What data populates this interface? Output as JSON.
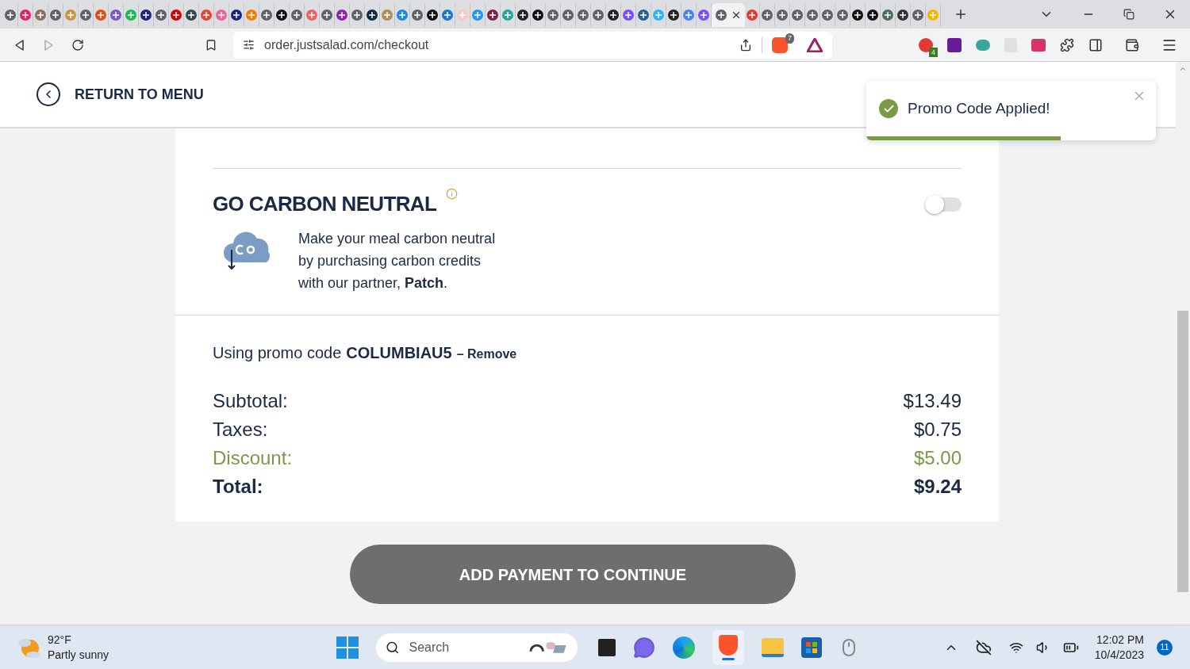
{
  "browser": {
    "tabs": [
      {
        "color": "#5f6368",
        "selected": false
      },
      {
        "color": "#e91e63",
        "selected": false
      },
      {
        "color": "#8d6e63",
        "selected": false
      },
      {
        "color": "#5f6368",
        "selected": false
      },
      {
        "color": "#c8963e",
        "selected": false
      },
      {
        "color": "#5f6368",
        "selected": false
      },
      {
        "color": "#e64a19",
        "selected": false
      },
      {
        "color": "#7e57c2",
        "selected": false
      },
      {
        "color": "#1db954",
        "selected": false
      },
      {
        "color": "#1a237e",
        "selected": false
      },
      {
        "color": "#5f6368",
        "selected": false
      },
      {
        "color": "#d50000",
        "selected": false
      },
      {
        "color": "#37474f",
        "selected": false
      },
      {
        "color": "#ea4335",
        "selected": false
      },
      {
        "color": "#f06292",
        "selected": false
      },
      {
        "color": "#1a237e",
        "selected": false
      },
      {
        "color": "#f57c00",
        "selected": false
      },
      {
        "color": "#5f6368",
        "selected": false
      },
      {
        "color": "#111111",
        "selected": false
      },
      {
        "color": "#5f6368",
        "selected": false
      },
      {
        "color": "#f06262",
        "selected": false
      },
      {
        "color": "#5f6368",
        "selected": false
      },
      {
        "color": "#8e24aa",
        "selected": false
      },
      {
        "color": "#5f6368",
        "selected": false
      },
      {
        "color": "#0d2b45",
        "selected": false
      },
      {
        "color": "#b08d57",
        "selected": false
      },
      {
        "color": "#1e88e5",
        "selected": false
      },
      {
        "color": "#5f6368",
        "selected": false
      },
      {
        "color": "#111111",
        "selected": false
      },
      {
        "color": "#1976d2",
        "selected": false
      },
      {
        "color": "#f8c8c8",
        "selected": false
      },
      {
        "color": "#2196f3",
        "selected": false
      },
      {
        "color": "#7b1f4b",
        "selected": false
      },
      {
        "color": "#26a69a",
        "selected": false
      },
      {
        "color": "#222222",
        "selected": false
      },
      {
        "color": "#111111",
        "selected": false
      },
      {
        "color": "#5f6368",
        "selected": false
      },
      {
        "color": "#5f6368",
        "selected": false
      },
      {
        "color": "#5f6368",
        "selected": false
      },
      {
        "color": "#5f6368",
        "selected": false
      },
      {
        "color": "#222222",
        "selected": false
      },
      {
        "color": "#7c4dff",
        "selected": false
      },
      {
        "color": "#2c5f8a",
        "selected": false
      },
      {
        "color": "#29b6f6",
        "selected": false
      },
      {
        "color": "#222222",
        "selected": false
      },
      {
        "color": "#4285f4",
        "selected": false
      },
      {
        "color": "#7c4dff",
        "selected": false
      },
      {
        "color": "#5f6368",
        "selected": true
      },
      {
        "color": "#e53935",
        "selected": false
      },
      {
        "color": "#5f6368",
        "selected": false
      },
      {
        "color": "#5f6368",
        "selected": false
      },
      {
        "color": "#5f6368",
        "selected": false
      },
      {
        "color": "#5f6368",
        "selected": false
      },
      {
        "color": "#5f6368",
        "selected": false
      },
      {
        "color": "#5f6368",
        "selected": false
      },
      {
        "color": "#111111",
        "selected": false
      },
      {
        "color": "#111111",
        "selected": false
      },
      {
        "color": "#4e6e5d",
        "selected": false
      },
      {
        "color": "#333333",
        "selected": false
      },
      {
        "color": "#5f6368",
        "selected": false
      },
      {
        "color": "#f4b400",
        "selected": false
      }
    ],
    "address": "order.justsalad.com/checkout",
    "shields_count": "7",
    "extension_badge": "4"
  },
  "header": {
    "back_link": "RETURN TO MENU"
  },
  "toast": {
    "message": "Promo Code Applied!",
    "level": 0.67
  },
  "carbon": {
    "title": "GO CARBON NEUTRAL",
    "on": false,
    "description": "Make your meal carbon neutral by purchasing carbon credits with our partner, **Patch**."
  },
  "promo": {
    "prefix": "Using promo code",
    "code": "COLUMBIAU5",
    "remove": "– Remove"
  },
  "totals": [
    {
      "kind": "normal",
      "label": "Subtotal:",
      "value": "$13.49"
    },
    {
      "kind": "normal",
      "label": "Taxes:",
      "value": "$0.75"
    },
    {
      "kind": "discount",
      "label": "Discount:",
      "value": "$5.00"
    },
    {
      "kind": "total",
      "label": "Total:",
      "value": "$9.24"
    }
  ],
  "payment_button": "ADD PAYMENT TO CONTINUE",
  "taskbar": {
    "weather_temp": "92°F",
    "weather_text": "Partly sunny",
    "search_placeholder": "Search",
    "time": "12:02 PM",
    "date": "10/4/2023",
    "notification_count": "11"
  }
}
